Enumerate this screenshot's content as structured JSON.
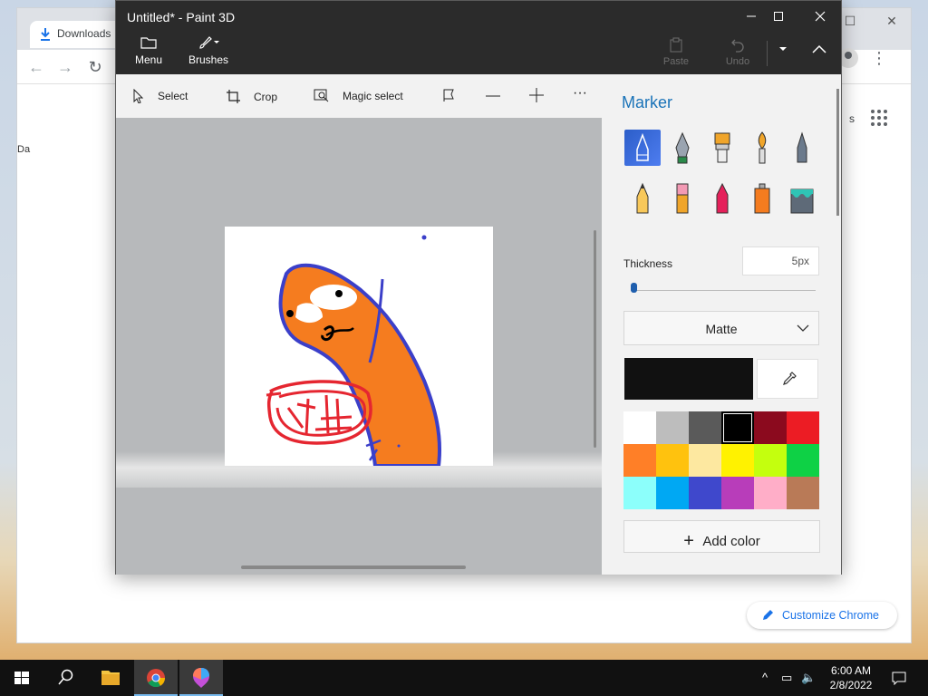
{
  "chrome": {
    "tab_label": "Downloads",
    "left_stub": "Da",
    "right_stub": "s",
    "customize_label": "Customize Chrome"
  },
  "paint3d": {
    "title": "Untitled* - Paint 3D",
    "toolbar": {
      "menu_label": "Menu",
      "brushes_label": "Brushes",
      "paste_label": "Paste",
      "undo_label": "Undo"
    },
    "tools": {
      "select_label": "Select",
      "crop_label": "Crop",
      "magic_select_label": "Magic select"
    },
    "panel": {
      "title": "Marker",
      "brushes": [
        "marker",
        "calligraphy-pen",
        "oil-brush",
        "watercolor",
        "pixel-pen",
        "pencil",
        "eraser",
        "crayon",
        "spray-can",
        "fill"
      ],
      "selected_brush": "marker",
      "thickness_label": "Thickness",
      "thickness_value": "5px",
      "thickness_fraction": 0.02,
      "finish_value": "Matte",
      "current_color": "#111111",
      "palette": [
        "#ffffff",
        "#bdbdbd",
        "#5a5a5a",
        "#000000",
        "#8b0a1e",
        "#ec1c24",
        "#ff7f27",
        "#ffc20e",
        "#fde8a0",
        "#fff200",
        "#c4ff0e",
        "#0ed145",
        "#8cfffb",
        "#00a8f3",
        "#3f48cc",
        "#b83dba",
        "#ffaec8",
        "#b97a57"
      ],
      "selected_color": "#000000",
      "add_color_label": "Add color"
    }
  },
  "taskbar": {
    "time": "6:00 AM",
    "date": "2/8/2022"
  }
}
